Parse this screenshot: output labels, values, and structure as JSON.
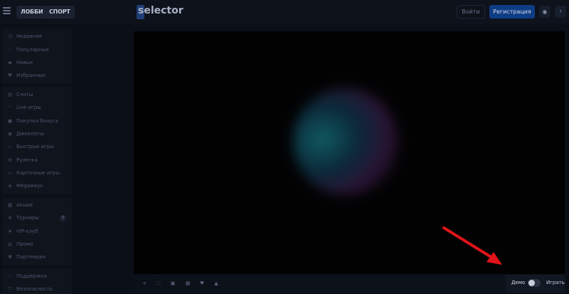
{
  "header": {
    "tabs": [
      {
        "label": "ЛОББИ"
      },
      {
        "label": "СПОРТ"
      }
    ],
    "logo_text": "selector",
    "login_label": "Войти",
    "register_label": "Регистрация",
    "collapse_label": "‹"
  },
  "sidebar": {
    "groups": [
      {
        "items": [
          {
            "label": "Недавние",
            "icon": "clock-icon"
          },
          {
            "label": "Популярные",
            "icon": "star-icon"
          },
          {
            "label": "Новые",
            "icon": "diamond-icon"
          },
          {
            "label": "Избранные",
            "icon": "heart-icon"
          }
        ]
      },
      {
        "items": [
          {
            "label": "Слоты",
            "icon": "slots-icon"
          },
          {
            "label": "Live игры",
            "icon": "headset-icon"
          },
          {
            "label": "Покупка бонуса",
            "icon": "bonus-icon"
          },
          {
            "label": "Джекпоты",
            "icon": "jackpot-icon"
          },
          {
            "label": "Быстрые игры",
            "icon": "flame-icon"
          },
          {
            "label": "Рулетка",
            "icon": "roulette-icon"
          },
          {
            "label": "Карточные игры",
            "icon": "cards-icon"
          },
          {
            "label": "Megaways",
            "icon": "megaways-icon"
          }
        ]
      },
      {
        "items": [
          {
            "label": "Акции",
            "icon": "promo-icon"
          },
          {
            "label": "Турниры",
            "icon": "trophy-icon",
            "badge": "0"
          },
          {
            "label": "VIP-клуб",
            "icon": "vip-star-icon"
          },
          {
            "label": "Промо",
            "icon": "gift-icon"
          },
          {
            "label": "Партнерам",
            "icon": "partner-icon"
          }
        ]
      },
      {
        "items": [
          {
            "label": "Поддержка",
            "icon": "support-icon"
          },
          {
            "label": "Безопасность",
            "icon": "shield-icon"
          }
        ]
      }
    ]
  },
  "game_toolbar": {
    "tools": [
      "plus-icon",
      "fullscreen-icon",
      "window-icon",
      "grid-icon",
      "heart-icon",
      "thumbs-up-icon"
    ]
  },
  "mode": {
    "demo_label": "Демо",
    "play_label": "Играть"
  },
  "colors": {
    "accent": "#0e3d86",
    "annotation_arrow": "#e0141a"
  }
}
